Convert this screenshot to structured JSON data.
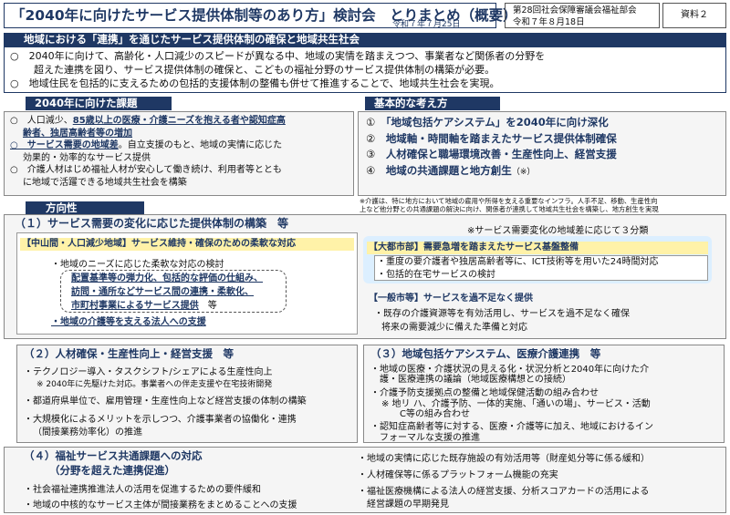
{
  "header": {
    "title": "「2040年に向けたサービス提供体制等のあり方」検討会　とりまとめ（概要）",
    "date": "令和７年７月25日",
    "meeting_line1": "第28回社会保障審議会福祉部会",
    "meeting_line2": "令和７年８月18日",
    "doc_label": "資料２"
  },
  "intro": {
    "heading": "地域における「連携」を通じたサービス提供体制の確保と地域共生社会",
    "p1_line1": "○　2040年に向けて、高齢化・人口減少のスピードが異なる中、地域の実情を踏まえつつ、事業者など関係者の分野を",
    "p1_line2": "超えた連携を図り、サービス提供体制の確保と、こどもの福祉分野のサービス提供体制の構築が必要。",
    "p2": "○　地域住民を包括的に支えるための包括的支援体制の整備も併せて推進することで、地域共生社会を実現。"
  },
  "issues": {
    "heading": "2040年に向けた課題",
    "i1_pre": "○　人口減少、",
    "i1_bold": "85歳以上の医療・介護ニーズを抱える者や認知症高",
    "i1_bold2": "齢者、独居高齢者等の増加",
    "i2_bold": "○　サービス需要の地域差",
    "i2_rest": "。自立支援のもと、地域の実情に応じた",
    "i2_line2": "効果的・効率的なサービス提供",
    "i3_line1": "○　介護人材はじめ福祉人材が安心して働き続け、利用者等ととも",
    "i3_line2": "に地域で活躍できる地域共生社会を構築"
  },
  "basic": {
    "heading": "基本的な考え方",
    "items": [
      {
        "num": "①",
        "text": "「地域包括ケアシステム」を2040年に向け深化"
      },
      {
        "num": "②",
        "text": "地域軸・時間軸を踏まえたサービス提供体制確保"
      },
      {
        "num": "③",
        "text": "人材確保と職場環境改善・生産性向上、経営支援"
      },
      {
        "num": "④",
        "text": "地域の共通課題と地方創生"
      },
      {
        "num": "",
        "text": "（※）"
      }
    ],
    "note_line1": "※介護は、特に地方において地域の雇用や所得を支える重要なインフラ。人手不足、移動、生産性向",
    "note_line2": "上など他分野との共通課題の解決に向け、関係者が連携して地域共生社会を構築し、地方創生を実現"
  },
  "direction": {
    "heading": "方向性"
  },
  "sec1": {
    "heading": "（１）サービス需要の変化に応じた提供体制の構築　等",
    "note": "※サービス需要変化の地域差に応じて３分類",
    "sub1_heading": "【中山間・人口減少地域】サービス維持・確保のための柔軟な対応",
    "sub1_i1": "・地域のニーズに応じた柔軟な対応の検討",
    "sub1_i2": "配置基準等の弾力化、包括的な評価の仕組み、",
    "sub1_i3": "訪問・通所などサービス間の連携・柔軟化、",
    "sub1_i4": "市町村事業によるサービス提供",
    "sub1_i4b": "　等",
    "sub1_i5": "・地域の介護等を支える法人への支援",
    "sub2_heading": "【大都市部】需要急増を踏まえたサービス基盤整備",
    "sub2_i1": "・重度の要介護者や独居高齢者等に、ICT技術等を用いた24時間対応",
    "sub2_i2": "・包括的在宅サービスの検討",
    "sub3_heading": "【一般市等】サービスを過不足なく提供",
    "sub3_i1": "・既存の介護資源等を有効活用し、サービスを過不足なく確保",
    "sub3_i2": "将来の需要減少に備えた準備と対応"
  },
  "sec2": {
    "heading": "（２）人材確保・生産性向上・経営支援　等",
    "i1": "・テクノロジー導入・タスクシフト/シェアによる生産性向上",
    "i1_note": "※ 2040年に先駆けた対応。事業者への伴走支援や在宅技術開発",
    "i2": "・都道府県単位で、雇用管理・生産性向上など経営支援の体制の構築",
    "i3": "・大規模化によるメリットを示しつつ、介護事業者の協働化・連携",
    "i3b": "（間接業務効率化）の推進"
  },
  "sec3": {
    "heading": "（３）地域包括ケアシステム、医療介護連携　等",
    "i1": "・地域の医療・介護状況の見える化・状況分析と2040年に向けた介",
    "i1b": "護・医療連携の議論（地域医療構想との接続）",
    "i2": "・介護予防支援拠点の整備と地域保健活動の組み合わせ",
    "i2_note": "※ 地リ ハ、介護予防、一体的実施、「通いの場」、サービス・活動",
    "i2_note2": "C等の組み合わせ",
    "i3": "・認知症高齢者等に対する、医療・介護等に加え、地域におけるイン",
    "i3b": "フォーマルな支援の推進"
  },
  "sec4": {
    "heading": "（４）福祉サービス共通課題への対応",
    "heading2": "（分野を超えた連携促進）",
    "l1": "・社会福祉連携推進法人の活用を促進するための要件緩和",
    "l2": "・地域の中核的なサービス主体が間接業務をまとめることへの支援",
    "r1": "・地域の実情に応じた既存施設の有効活用等（財産処分等に係る緩和）",
    "r2": "・人材確保等に係るプラットフォーム機能の充実",
    "r3": "・福祉医療機構による法人の経営支援、分析スコアカードの活用による",
    "r3b": "経営課題の早期発見"
  }
}
